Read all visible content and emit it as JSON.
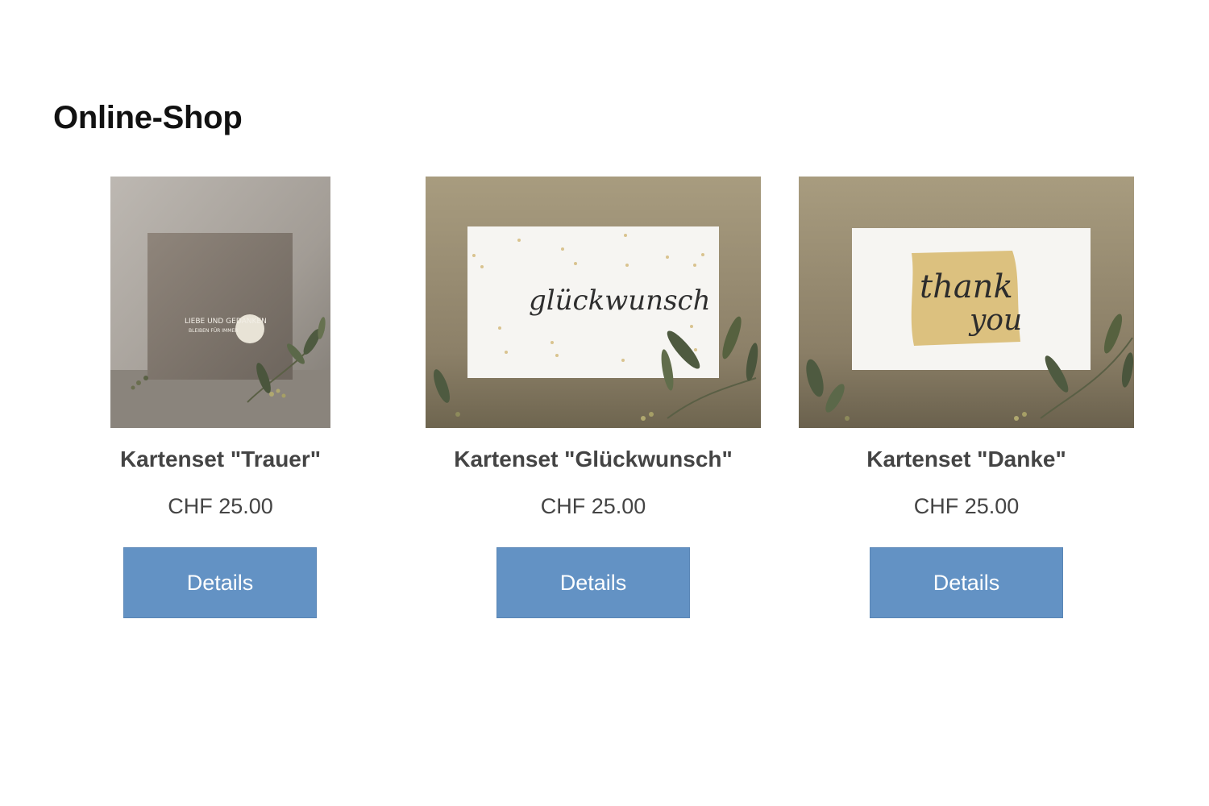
{
  "page": {
    "title": "Online-Shop"
  },
  "products": [
    {
      "name": "Kartenset \"Trauer\"",
      "price": "CHF 25.00",
      "button_label": "Details",
      "card_text_line1": "LIEBE UND GEDANKEN",
      "card_text_line2": "BLEIBEN FÜR IMMER"
    },
    {
      "name": "Kartenset \"Glückwunsch\"",
      "price": "CHF 25.00",
      "button_label": "Details",
      "card_text": "glückwunsch"
    },
    {
      "name": "Kartenset \"Danke\"",
      "price": "CHF 25.00",
      "button_label": "Details",
      "card_text_line1": "thank",
      "card_text_line2": "you"
    }
  ],
  "colors": {
    "button": "#6392c4",
    "button_text": "#ffffff",
    "text": "#444444",
    "title": "#111111"
  },
  "icons": {
    "foliage": "eucalyptus-sprig"
  }
}
